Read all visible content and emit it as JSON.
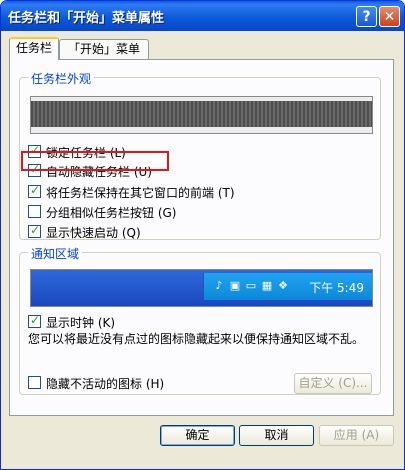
{
  "window": {
    "title": "任务栏和「开始」菜单属性"
  },
  "tabs": [
    {
      "label": "任务栏"
    },
    {
      "label": "「开始」菜单"
    }
  ],
  "appearance": {
    "group_label": "任务栏外观",
    "options": [
      {
        "label": "锁定任务栏 (L)",
        "checked": true
      },
      {
        "label": "自动隐藏任务栏 (U)",
        "checked": true
      },
      {
        "label": "将任务栏保持在其它窗口的前端 (T)",
        "checked": true
      },
      {
        "label": "分组相似任务栏按钮 (G)",
        "checked": false
      },
      {
        "label": "显示快速启动 (Q)",
        "checked": true
      }
    ]
  },
  "notification": {
    "group_label": "通知区域",
    "clock": "下午 5:49",
    "show_clock": {
      "label": "显示时钟 (K)",
      "checked": true
    },
    "description": "您可以将最近没有点过的图标隐藏起来以便保持通知区域不乱。",
    "hide_inactive": {
      "label": "隐藏不活动的图标 (H)",
      "checked": false
    },
    "customize_label": "自定义 (C)..."
  },
  "buttons": {
    "ok": "确定",
    "cancel": "取消",
    "apply": "应用 (A)"
  },
  "colors": {
    "title_blue": "#0a5fe0",
    "highlight_red": "#e0161b",
    "group_label_blue": "#0046d5"
  }
}
